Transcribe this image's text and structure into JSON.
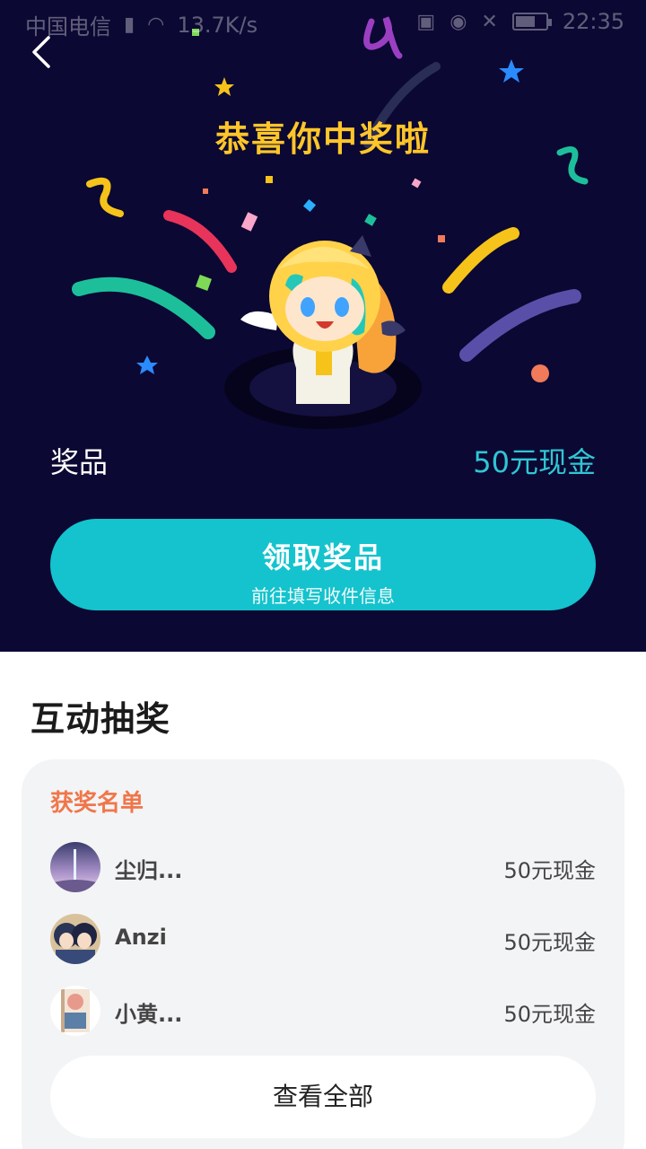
{
  "status_bar": {
    "carrier": "中国电信",
    "speed": "13.7K/s",
    "time": "22:35"
  },
  "hero": {
    "title": "恭喜你中奖啦",
    "prize_label": "奖品",
    "prize_value": "50元现金",
    "claim_button": {
      "title": "领取奖品",
      "subtitle": "前往填写收件信息"
    }
  },
  "section": {
    "title": "互动抽奖"
  },
  "winners": {
    "heading": "获奖名单",
    "items": [
      {
        "name": "尘归...",
        "prize": "50元现金"
      },
      {
        "name": "Anzi",
        "prize": "50元现金"
      },
      {
        "name": "小黄...",
        "prize": "50元现金"
      }
    ],
    "view_all_label": "查看全部"
  },
  "colors": {
    "hero_bg": "#0b0833",
    "title_yellow": "#ffc629",
    "accent_teal": "#14c3cd",
    "prize_teal": "#2fc6d3",
    "heading_orange": "#f0764a"
  }
}
